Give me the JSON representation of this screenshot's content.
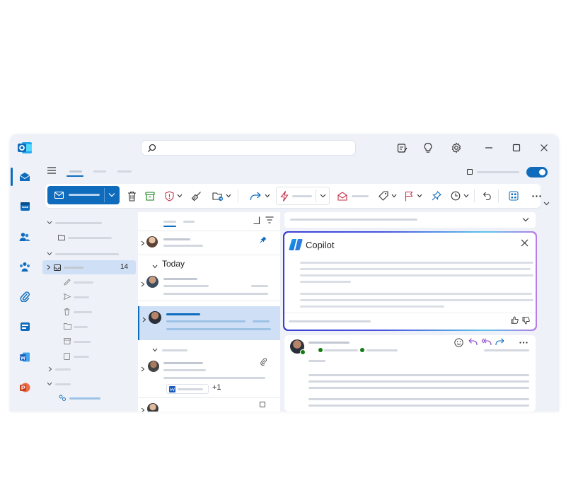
{
  "folder_pane": {
    "inbox_count": "14"
  },
  "message_list": {
    "group_today": "Today"
  },
  "attachment": {
    "extra_count": "+1"
  },
  "copilot": {
    "title": "Copilot"
  },
  "colors": {
    "accent": "#0f6cbd",
    "window_bg": "#eef2f8",
    "selected_row": "#cfe0f6",
    "flag": "#c4314b"
  },
  "icons": {
    "app": "outlook-logo-icon",
    "search": "search-icon",
    "new_mail": "mail-icon",
    "delete": "trash-icon",
    "archive": "archive-icon",
    "report": "shield-icon",
    "sweep": "broom-icon",
    "move": "folder-move-icon",
    "forward": "forward-icon",
    "rules": "lightning-icon",
    "read": "envelope-open-icon",
    "tag": "tag-icon",
    "flag": "flag-icon",
    "pin": "pin-icon",
    "snooze": "clock-icon",
    "undo": "undo-icon",
    "apps": "apps-icon",
    "more": "more-icon"
  }
}
